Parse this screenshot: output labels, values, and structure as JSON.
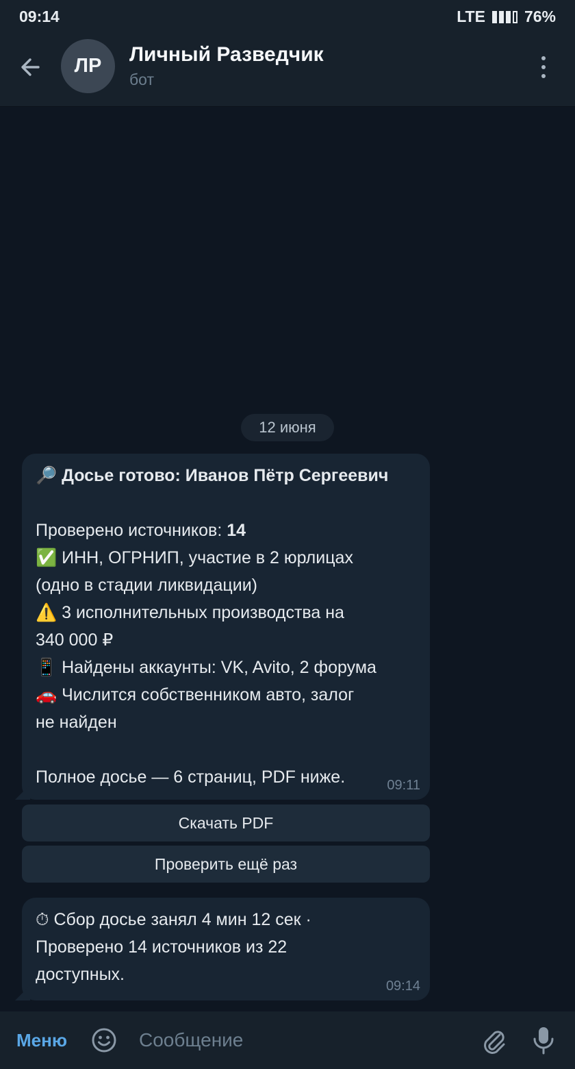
{
  "status": {
    "time": "09:14",
    "network": "LTE",
    "battery": "76%"
  },
  "header": {
    "avatar_initials": "ЛР",
    "title": "Личный Разведчик",
    "subtitle": "бот"
  },
  "date_separator": "12 июня",
  "messages": [
    {
      "title_emoji": "🔎",
      "title": "Досье готово: Иванов Пётр Сергеевич",
      "sources_label": "Проверено источников: ",
      "sources_count": "14",
      "line1_emoji": "✅",
      "line1": "ИНН, ОГРНИП, участие в 2 юрлицах",
      "line1b": "(одно в стадии ликвидации)",
      "line2_emoji": "⚠️",
      "line2": "3 исполнительных производства на",
      "line2b": "340 000 ₽",
      "line3_emoji": "📱",
      "line3": "Найдены аккаунты: VK, Avito, 2 форума",
      "line4_emoji": "🚗",
      "line4": "Числится собственником авто, залог",
      "line4b": "не найден",
      "footer": "Полное досье — 6 страниц, PDF ниже.",
      "time": "09:11"
    },
    {
      "emoji": "⏱",
      "line1": "Сбор досье занял 4 мин 12 сек ·",
      "line2": "Проверено 14 источников из 22",
      "line3": "доступных.",
      "time": "09:14"
    }
  ],
  "inline_buttons": [
    "Скачать PDF",
    "Проверить ещё раз"
  ],
  "composer": {
    "menu_label": "Меню",
    "placeholder": "Сообщение"
  },
  "colors": {
    "background": "#0e1621",
    "header": "#17212b",
    "bubble": "#182533",
    "accent": "#5aa7e6"
  }
}
